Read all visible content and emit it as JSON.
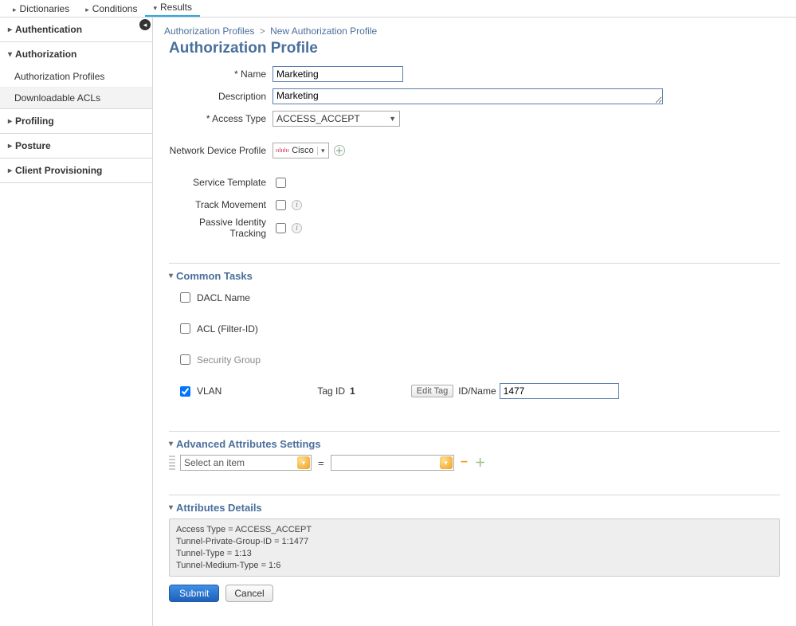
{
  "tabs": {
    "dict": "Dictionaries",
    "cond": "Conditions",
    "res": "Results"
  },
  "sidebar": {
    "auth": "Authentication",
    "authorization": "Authorization",
    "profiles": "Authorization Profiles",
    "dacls": "Downloadable ACLs",
    "profiling": "Profiling",
    "posture": "Posture",
    "client": "Client Provisioning"
  },
  "breadcrumb": {
    "root": "Authorization Profiles",
    "sep": ">",
    "leaf": "New Authorization Profile"
  },
  "title": "Authorization Profile",
  "form": {
    "name_label": "* Name",
    "name_value": "Marketing",
    "desc_label": "Description",
    "desc_value": "Marketing",
    "access_label": "* Access Type",
    "access_value": "ACCESS_ACCEPT",
    "ndp_label": "Network Device Profile",
    "ndp_value": "Cisco",
    "svc_label": "Service Template",
    "track_label": "Track Movement",
    "pit_label": "Passive Identity Tracking"
  },
  "common": {
    "heading": "Common Tasks",
    "dacl": "DACL Name",
    "acl": "ACL  (Filter-ID)",
    "sg": "Security Group",
    "vlan": "VLAN",
    "tagid_label": "Tag ID",
    "tagid_value": "1",
    "edit_tag": "Edit Tag",
    "idname_label": "ID/Name",
    "idname_value": "1477"
  },
  "adv": {
    "heading": "Advanced Attributes Settings",
    "placeholder": "Select an item",
    "eq": "="
  },
  "details": {
    "heading": "Attributes Details",
    "l1": "Access Type = ACCESS_ACCEPT",
    "l2": "Tunnel-Private-Group-ID = 1:1477",
    "l3": "Tunnel-Type = 1:13",
    "l4": "Tunnel-Medium-Type = 1:6"
  },
  "actions": {
    "submit": "Submit",
    "cancel": "Cancel"
  }
}
